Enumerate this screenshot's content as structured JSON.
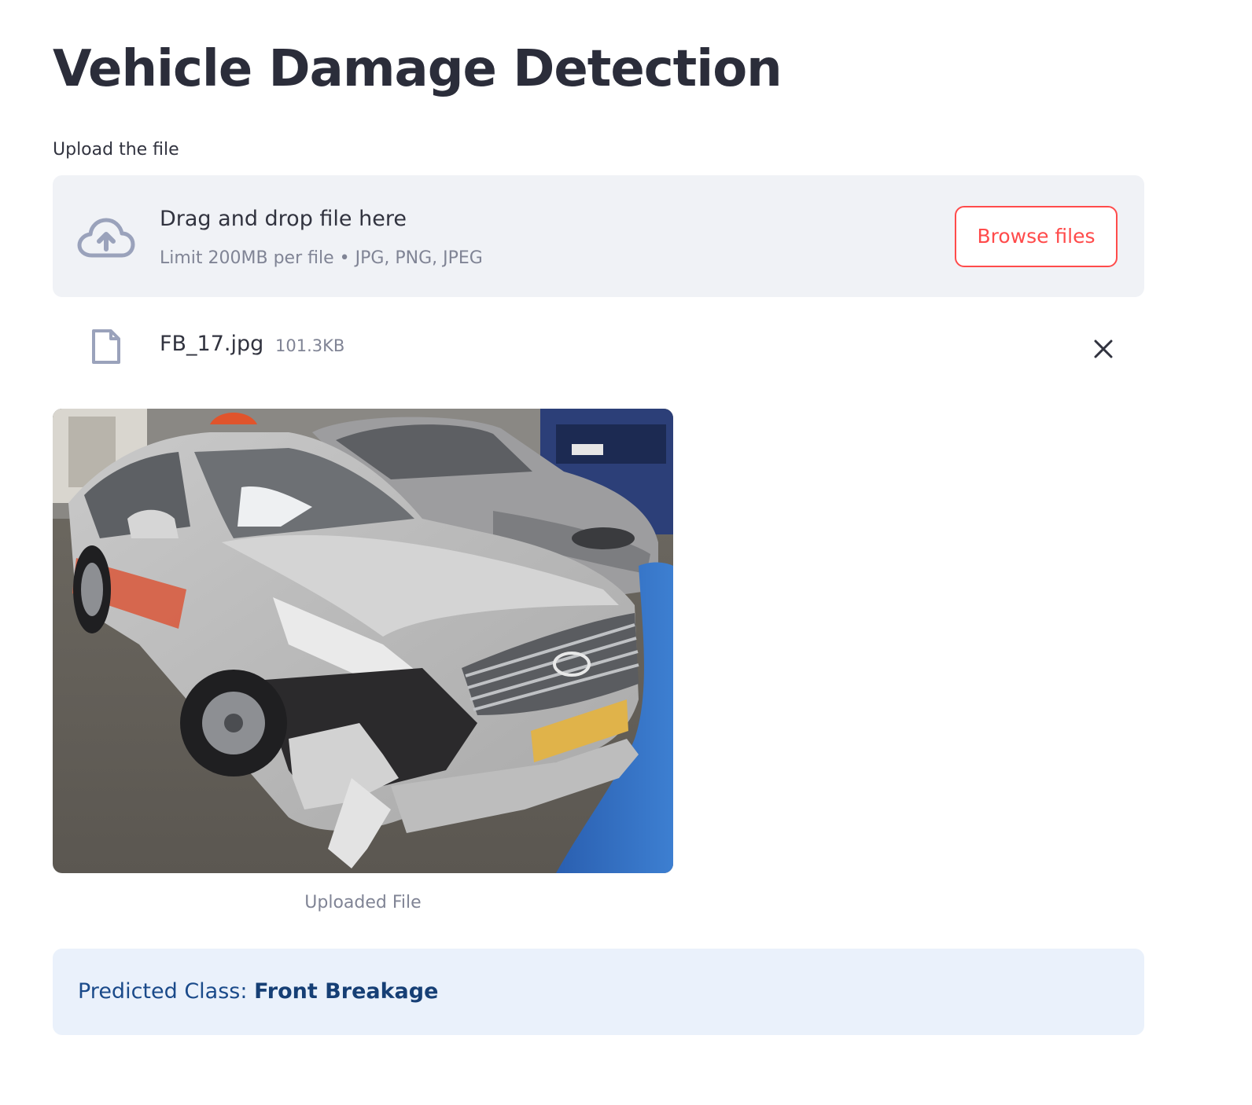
{
  "page": {
    "title": "Vehicle Damage Detection"
  },
  "uploader": {
    "label": "Upload the file",
    "drop_title": "Drag and drop file here",
    "drop_hint": "Limit 200MB per file • JPG, PNG, JPEG",
    "browse_label": "Browse files",
    "icon": "cloud-upload-icon"
  },
  "uploaded_file": {
    "name": "FB_17.jpg",
    "size": "101.3KB",
    "icon": "file-icon",
    "remove_icon": "close-icon"
  },
  "image": {
    "caption": "Uploaded File"
  },
  "result": {
    "label": "Predicted Class:",
    "value": "Front Breakage"
  },
  "colors": {
    "accent": "#ff4b4b",
    "dropzone_bg": "#f0f2f6",
    "info_bg": "#eaf1fb",
    "info_text": "#1a4a8a",
    "muted_text": "#808495"
  }
}
